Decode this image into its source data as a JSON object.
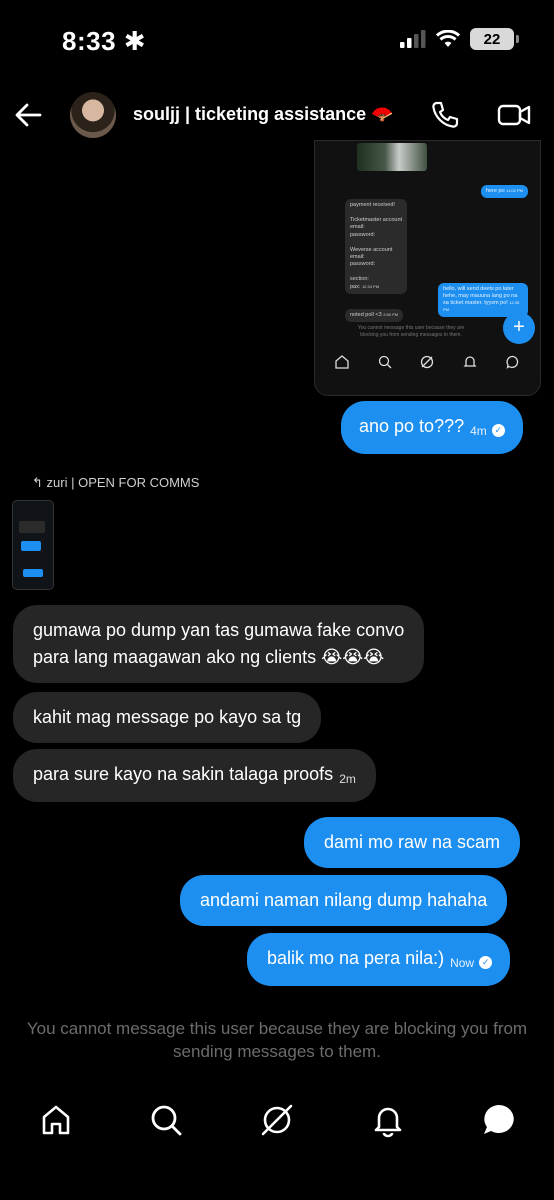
{
  "status_bar": {
    "time": "8:33",
    "battery": "22"
  },
  "header": {
    "title": "souljj | ticketing assistance 🪭"
  },
  "embedded_screenshot": {
    "bubble_here_po": "here po",
    "time_here_po": "11:02 PM",
    "received_block": "payment received!\n\nTicketmaster account\nemail:\npassword:\n\nWeverse account\nemail:\npassword:\n\nsection:\npax:",
    "received_time": "12:34 PM",
    "reply_block": "hello, will send deets po later hehe, may mauuna lang po na sa ticket master. tyysm po!",
    "reply_time": "12:35 PM",
    "noted_text": "noted poll <3",
    "noted_time": "2:50 PM",
    "blocked_note": "You cannot message this user because they are blocking you from sending messages to them.",
    "fab_label": "+"
  },
  "messages": {
    "m1": {
      "text": "ano po to???",
      "time": "4m"
    },
    "reply_label": "zuri | OPEN FOR COMMS",
    "m2_line1": "gumawa po dump yan tas gumawa fake convo",
    "m2_line2": "para lang maagawan ako ng clients 😭😭😭",
    "m3": "kahit mag message po kayo sa tg",
    "m4": {
      "text": "para sure kayo na sakin talaga proofs",
      "time": "2m"
    },
    "m5": "dami mo raw na scam",
    "m6": "andami naman nilang dump hahaha",
    "m7": {
      "text": "balik mo na pera nila:)",
      "time": "Now"
    }
  },
  "blocked_note": "You cannot message this user because they are blocking you from sending messages to them.",
  "colors": {
    "background": "#000000",
    "outgoing_bubble": "#1d8ff0",
    "incoming_bubble": "#262626",
    "note_text": "#6c6c6c"
  },
  "icons": [
    "back-arrow",
    "phone",
    "video-camera",
    "home",
    "search",
    "compass",
    "bell",
    "chat"
  ]
}
